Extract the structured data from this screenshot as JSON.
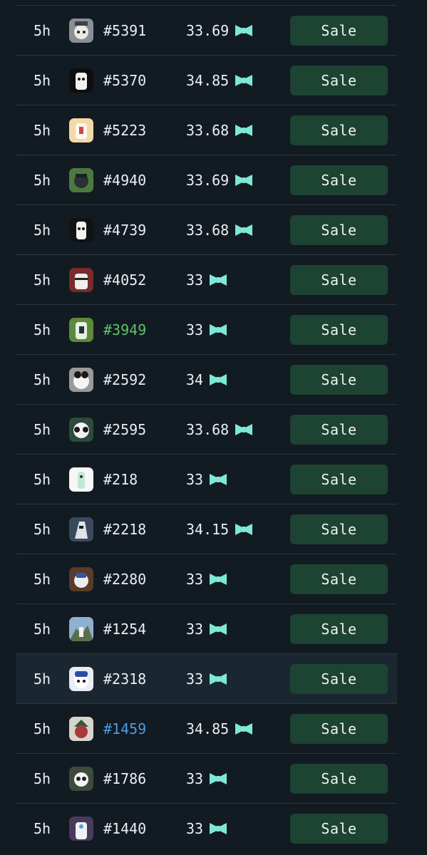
{
  "icons": {
    "currency": "bow-tie-icon"
  },
  "colors": {
    "background": "#121a22",
    "sale_button": "#1d4332",
    "currency_icon": "#7ee8d6",
    "link_green": "#5ec26c",
    "link_blue": "#4d9be6"
  },
  "sales": [
    {
      "time": "5h",
      "token": "#5391",
      "price": "33.69",
      "action": "Sale"
    },
    {
      "time": "5h",
      "token": "#5370",
      "price": "34.85",
      "action": "Sale"
    },
    {
      "time": "5h",
      "token": "#5223",
      "price": "33.68",
      "action": "Sale"
    },
    {
      "time": "5h",
      "token": "#4940",
      "price": "33.69",
      "action": "Sale"
    },
    {
      "time": "5h",
      "token": "#4739",
      "price": "33.68",
      "action": "Sale"
    },
    {
      "time": "5h",
      "token": "#4052",
      "price": "33",
      "action": "Sale"
    },
    {
      "time": "5h",
      "token": "#3949",
      "price": "33",
      "action": "Sale"
    },
    {
      "time": "5h",
      "token": "#2592",
      "price": "34",
      "action": "Sale"
    },
    {
      "time": "5h",
      "token": "#2595",
      "price": "33.68",
      "action": "Sale"
    },
    {
      "time": "5h",
      "token": "#218",
      "price": "33",
      "action": "Sale"
    },
    {
      "time": "5h",
      "token": "#2218",
      "price": "34.15",
      "action": "Sale"
    },
    {
      "time": "5h",
      "token": "#2280",
      "price": "33",
      "action": "Sale"
    },
    {
      "time": "5h",
      "token": "#1254",
      "price": "33",
      "action": "Sale"
    },
    {
      "time": "5h",
      "token": "#2318",
      "price": "33",
      "action": "Sale"
    },
    {
      "time": "5h",
      "token": "#1459",
      "price": "34.85",
      "action": "Sale"
    },
    {
      "time": "5h",
      "token": "#1786",
      "price": "33",
      "action": "Sale"
    },
    {
      "time": "5h",
      "token": "#1440",
      "price": "33",
      "action": "Sale"
    }
  ]
}
